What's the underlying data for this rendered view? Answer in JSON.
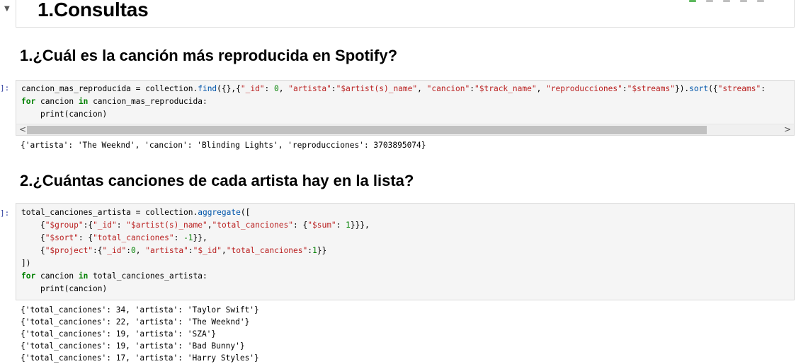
{
  "notebook": {
    "section_title": "1.Consultas",
    "queries": [
      {
        "heading": "1.¿Cuál es la canción más reproducida en Spotify?",
        "prompt": "]:",
        "code_lines": [
          [
            {
              "t": "cancion_mas_reproducida = collection.",
              "c": ""
            },
            {
              "t": "find",
              "c": "fn"
            },
            {
              "t": "({},{",
              "c": ""
            },
            {
              "t": "\"_id\"",
              "c": "str"
            },
            {
              "t": ": ",
              "c": ""
            },
            {
              "t": "0",
              "c": "num"
            },
            {
              "t": ", ",
              "c": ""
            },
            {
              "t": "\"artista\"",
              "c": "str"
            },
            {
              "t": ":",
              "c": ""
            },
            {
              "t": "\"$artist(s)_name\"",
              "c": "str"
            },
            {
              "t": ", ",
              "c": ""
            },
            {
              "t": "\"cancion\"",
              "c": "str"
            },
            {
              "t": ":",
              "c": ""
            },
            {
              "t": "\"$track_name\"",
              "c": "str"
            },
            {
              "t": ", ",
              "c": ""
            },
            {
              "t": "\"reproducciones\"",
              "c": "str"
            },
            {
              "t": ":",
              "c": ""
            },
            {
              "t": "\"$streams\"",
              "c": "str"
            },
            {
              "t": "}).",
              "c": ""
            },
            {
              "t": "sort",
              "c": "fn"
            },
            {
              "t": "({",
              "c": ""
            },
            {
              "t": "\"streams\"",
              "c": "str"
            },
            {
              "t": ":",
              "c": ""
            }
          ],
          [
            {
              "t": "for",
              "c": "kw"
            },
            {
              "t": " cancion ",
              "c": ""
            },
            {
              "t": "in",
              "c": "kw"
            },
            {
              "t": " cancion_mas_reproducida:",
              "c": ""
            }
          ],
          [
            {
              "t": "    print(cancion)",
              "c": ""
            }
          ]
        ],
        "output_lines": [
          "{'artista': 'The Weeknd', 'cancion': 'Blinding Lights', 'reproducciones': 3703895074}"
        ]
      },
      {
        "heading": "2.¿Cuántas canciones de cada artista hay en la lista?",
        "prompt": "]:",
        "code_lines": [
          [
            {
              "t": "total_canciones_artista = collection.",
              "c": ""
            },
            {
              "t": "aggregate",
              "c": "fn"
            },
            {
              "t": "([",
              "c": ""
            }
          ],
          [
            {
              "t": "    {",
              "c": ""
            },
            {
              "t": "\"$group\"",
              "c": "str"
            },
            {
              "t": ":{",
              "c": ""
            },
            {
              "t": "\"_id\"",
              "c": "str"
            },
            {
              "t": ": ",
              "c": ""
            },
            {
              "t": "\"$artist(s)_name\"",
              "c": "str"
            },
            {
              "t": ",",
              "c": ""
            },
            {
              "t": "\"total_canciones\"",
              "c": "str"
            },
            {
              "t": ": {",
              "c": ""
            },
            {
              "t": "\"$sum\"",
              "c": "str"
            },
            {
              "t": ": ",
              "c": ""
            },
            {
              "t": "1",
              "c": "num"
            },
            {
              "t": "}}},",
              "c": ""
            }
          ],
          [
            {
              "t": "    {",
              "c": ""
            },
            {
              "t": "\"$sort\"",
              "c": "str"
            },
            {
              "t": ": {",
              "c": ""
            },
            {
              "t": "\"total_canciones\"",
              "c": "str"
            },
            {
              "t": ": ",
              "c": ""
            },
            {
              "t": "-1",
              "c": "num"
            },
            {
              "t": "}},",
              "c": ""
            }
          ],
          [
            {
              "t": "    {",
              "c": ""
            },
            {
              "t": "\"$project\"",
              "c": "str"
            },
            {
              "t": ":{",
              "c": ""
            },
            {
              "t": "\"_id\"",
              "c": "str"
            },
            {
              "t": ":",
              "c": ""
            },
            {
              "t": "0",
              "c": "num"
            },
            {
              "t": ", ",
              "c": ""
            },
            {
              "t": "\"artista\"",
              "c": "str"
            },
            {
              "t": ":",
              "c": ""
            },
            {
              "t": "\"$_id\"",
              "c": "str"
            },
            {
              "t": ",",
              "c": ""
            },
            {
              "t": "\"total_canciones\"",
              "c": "str"
            },
            {
              "t": ":",
              "c": ""
            },
            {
              "t": "1",
              "c": "num"
            },
            {
              "t": "}}",
              "c": ""
            }
          ],
          [
            {
              "t": "])",
              "c": ""
            }
          ],
          [
            {
              "t": "for",
              "c": "kw"
            },
            {
              "t": " cancion ",
              "c": ""
            },
            {
              "t": "in",
              "c": "kw"
            },
            {
              "t": " total_canciones_artista:",
              "c": ""
            }
          ],
          [
            {
              "t": "    print(cancion)",
              "c": ""
            }
          ]
        ],
        "output_lines": [
          "{'total_canciones': 34, 'artista': 'Taylor Swift'}",
          "{'total_canciones': 22, 'artista': 'The Weeknd'}",
          "{'total_canciones': 19, 'artista': 'SZA'}",
          "{'total_canciones': 19, 'artista': 'Bad Bunny'}",
          "{'total_canciones': 17, 'artista': 'Harry Styles'}"
        ]
      }
    ],
    "scrollbar": {
      "left_arrow": "<",
      "right_arrow": ">"
    },
    "icons": {
      "collapse": "caret-down-icon"
    }
  }
}
